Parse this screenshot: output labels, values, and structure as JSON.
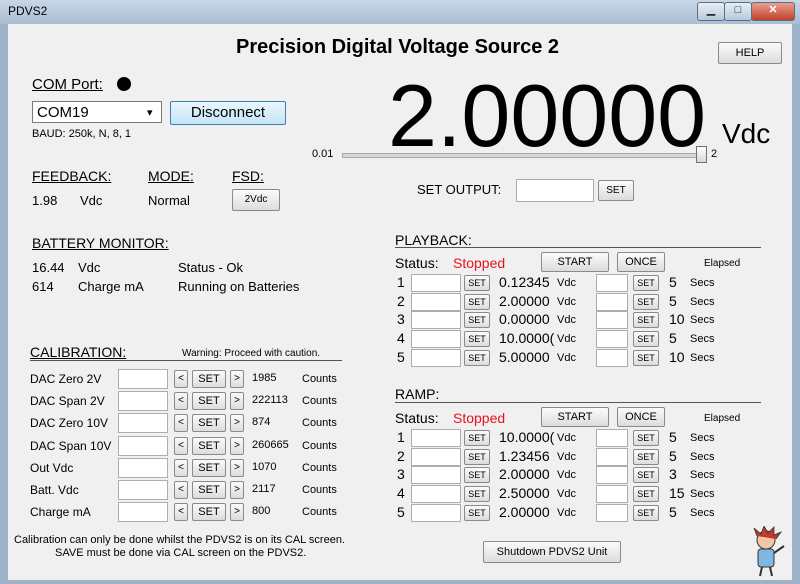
{
  "window": {
    "title": "PDVS2",
    "minimize": "▁",
    "maximize": "□",
    "close": "✕"
  },
  "header": {
    "title": "Precision Digital Voltage Source 2",
    "help_label": "HELP"
  },
  "com": {
    "label": "COM Port:",
    "port_value": "COM19",
    "disconnect_label": "Disconnect",
    "baud": "BAUD: 250k, N, 8, 1"
  },
  "output": {
    "value": "2.00000",
    "unit": "Vdc",
    "slider_min": "0.01",
    "slider_max": "2",
    "slider_fraction": 1.0,
    "set_label": "SET OUTPUT:",
    "set_button": "SET"
  },
  "feedback": {
    "label": "FEEDBACK:",
    "value": "1.98",
    "unit": "Vdc"
  },
  "mode": {
    "label": "MODE:",
    "value": "Normal"
  },
  "fsd": {
    "label": "FSD:",
    "button": "2Vdc"
  },
  "battery": {
    "label": "BATTERY MONITOR:",
    "voltage": "16.44",
    "voltage_unit": "Vdc",
    "charge": "614",
    "charge_unit": "Charge mA",
    "status": "Status - Ok",
    "source": "Running on Batteries"
  },
  "calibration": {
    "label": "CALIBRATION:",
    "warning": "Warning: Proceed with caution.",
    "rows": [
      {
        "name": "DAC Zero 2V",
        "value": "1985",
        "unit": "Counts"
      },
      {
        "name": "DAC Span 2V",
        "value": "222113",
        "unit": "Counts"
      },
      {
        "name": "DAC Zero 10V",
        "value": "874",
        "unit": "Counts"
      },
      {
        "name": "DAC Span 10V",
        "value": "260665",
        "unit": "Counts"
      },
      {
        "name": "Out Vdc",
        "value": "1070",
        "unit": "Counts"
      },
      {
        "name": "Batt. Vdc",
        "value": "2117",
        "unit": "Counts"
      },
      {
        "name": "Charge mA",
        "value": "800",
        "unit": "Counts"
      }
    ],
    "note1": "Calibration can only be done whilst the PDVS2 is on its CAL screen.",
    "note2": "SAVE must be done via CAL screen on the PDVS2.",
    "dec": "<",
    "inc": ">",
    "set": "SET"
  },
  "playback": {
    "label": "PLAYBACK:",
    "status_label": "Status:",
    "status": "Stopped",
    "start": "START",
    "once": "ONCE",
    "elapsed": "Elapsed",
    "rows": [
      {
        "n": "1",
        "value": "0.12345",
        "unit": "Vdc",
        "secs": "5",
        "secs_unit": "Secs"
      },
      {
        "n": "2",
        "value": "2.00000",
        "unit": "Vdc",
        "secs": "5",
        "secs_unit": "Secs"
      },
      {
        "n": "3",
        "value": "0.00000",
        "unit": "Vdc",
        "secs": "10",
        "secs_unit": "Secs"
      },
      {
        "n": "4",
        "value": "10.0000(",
        "unit": "Vdc",
        "secs": "5",
        "secs_unit": "Secs"
      },
      {
        "n": "5",
        "value": "5.00000",
        "unit": "Vdc",
        "secs": "10",
        "secs_unit": "Secs"
      }
    ]
  },
  "ramp": {
    "label": "RAMP:",
    "status_label": "Status:",
    "status": "Stopped",
    "start": "START",
    "once": "ONCE",
    "elapsed": "Elapsed",
    "rows": [
      {
        "n": "1",
        "value": "10.0000(",
        "unit": "Vdc",
        "secs": "5",
        "secs_unit": "Secs"
      },
      {
        "n": "2",
        "value": "1.23456",
        "unit": "Vdc",
        "secs": "5",
        "secs_unit": "Secs"
      },
      {
        "n": "3",
        "value": "2.00000",
        "unit": "Vdc",
        "secs": "3",
        "secs_unit": "Secs"
      },
      {
        "n": "4",
        "value": "2.50000",
        "unit": "Vdc",
        "secs": "15",
        "secs_unit": "Secs"
      },
      {
        "n": "5",
        "value": "2.00000",
        "unit": "Vdc",
        "secs": "5",
        "secs_unit": "Secs"
      }
    ]
  },
  "seq_set": "SET",
  "shutdown_label": "Shutdown PDVS2 Unit",
  "colors": {
    "status": "#e8121a",
    "accent": "#000000"
  }
}
